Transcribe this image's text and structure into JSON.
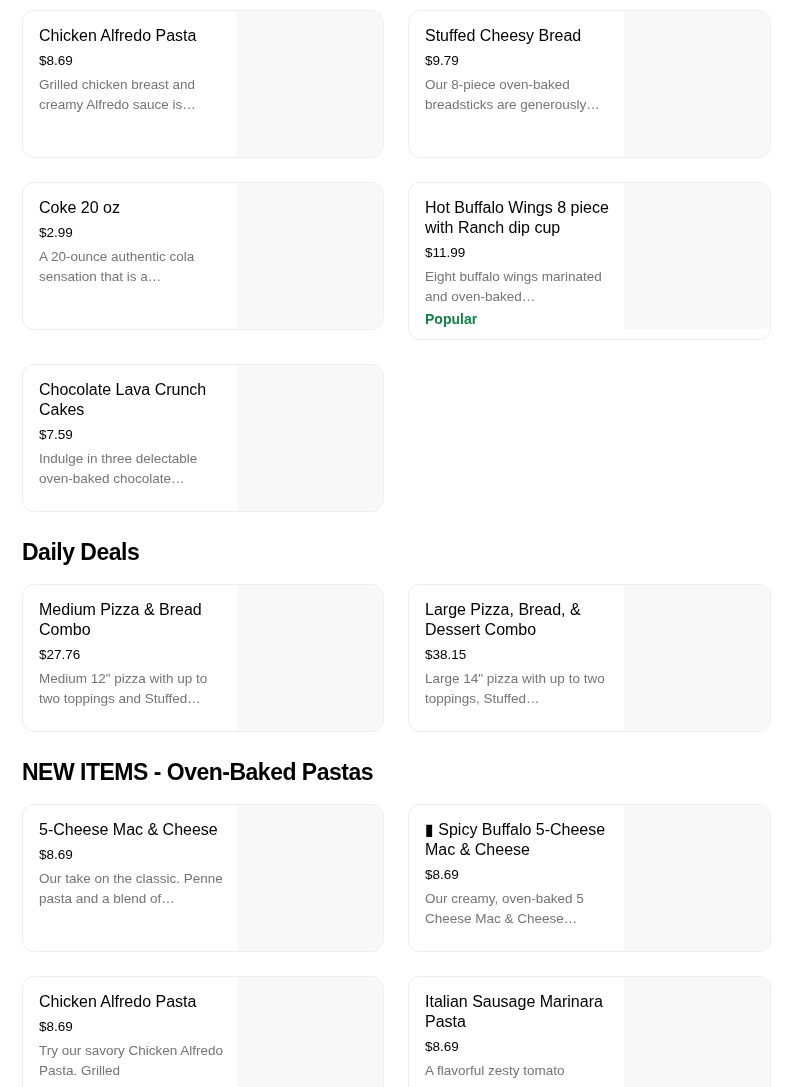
{
  "sections": [
    {
      "items": [
        {
          "name": "Chicken Alfredo Pasta",
          "price": "$8.69",
          "description": "Grilled chicken breast and creamy Alfredo sauce is…"
        },
        {
          "name": "Stuffed Cheesy Bread",
          "price": "$9.79",
          "description": "Our 8-piece oven-baked breadsticks are generously…"
        },
        {
          "name": "Coke 20 oz",
          "price": "$2.99",
          "description": "A 20-ounce authentic cola sensation that is a…"
        },
        {
          "name": "Hot Buffalo Wings 8 piece with Ranch dip cup",
          "price": "$11.99",
          "description": "Eight buffalo wings marinated and oven-baked…",
          "badge": "Popular"
        },
        {
          "name": "Chocolate Lava Crunch Cakes",
          "price": "$7.59",
          "description": "Indulge in three delectable oven-baked chocolate…"
        }
      ]
    },
    {
      "heading": "Daily Deals",
      "items": [
        {
          "name": "Medium Pizza & Bread Combo",
          "price": "$27.76",
          "description": "Medium 12\" pizza with up to two toppings and Stuffed…"
        },
        {
          "name": "Large Pizza, Bread, & Dessert Combo",
          "price": "$38.15",
          "description": "Large 14\" pizza with up to two toppings, Stuffed…"
        }
      ]
    },
    {
      "heading": "NEW ITEMS - Oven-Baked Pastas",
      "items": [
        {
          "name": "5-Cheese Mac & Cheese",
          "price": "$8.69",
          "description": "Our take on the classic. Penne pasta and a blend of…"
        },
        {
          "name": "▮ Spicy Buffalo 5-Cheese Mac & Cheese",
          "price": "$8.69",
          "description": "Our creamy, oven-baked 5 Cheese Mac & Cheese…"
        },
        {
          "name": "Chicken Alfredo Pasta",
          "price": "$8.69",
          "description": "Try our savory Chicken Alfredo Pasta. Grilled"
        },
        {
          "name": "Italian Sausage Marinara Pasta",
          "price": "$8.69",
          "description": "A flavorful zesty tomato"
        }
      ]
    }
  ]
}
